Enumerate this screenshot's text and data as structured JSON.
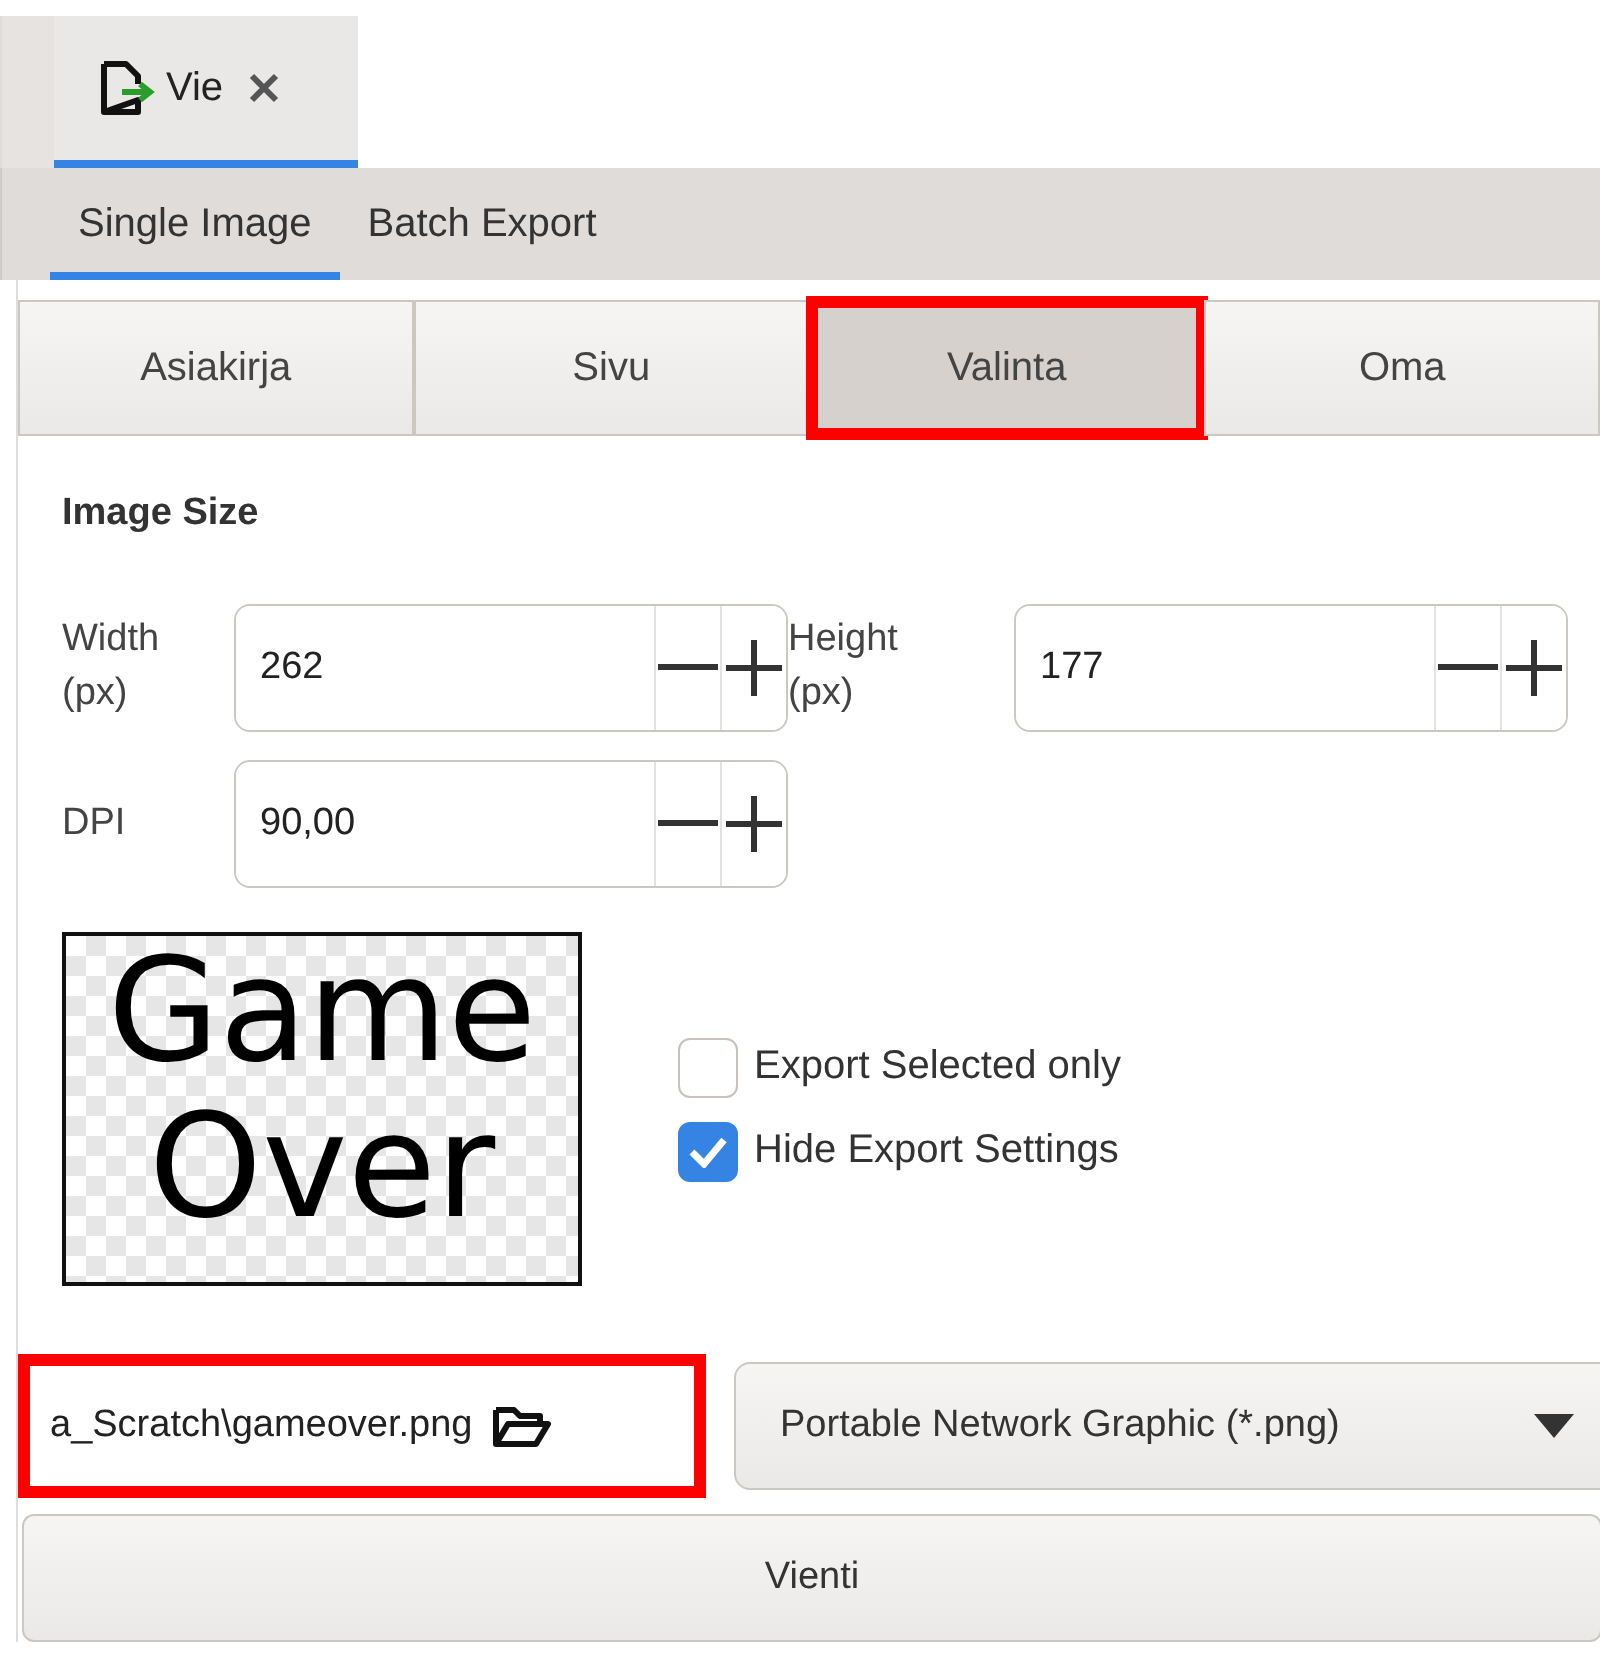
{
  "doc_tab": {
    "label": "Vie",
    "selected": true
  },
  "tabs": [
    {
      "label": "Single Image",
      "selected": true
    },
    {
      "label": "Batch Export",
      "selected": false
    }
  ],
  "scopes": [
    {
      "label": "Asiakirja",
      "selected": false,
      "highlighted": false
    },
    {
      "label": "Sivu",
      "selected": false,
      "highlighted": false
    },
    {
      "label": "Valinta",
      "selected": true,
      "highlighted": true
    },
    {
      "label": "Oma",
      "selected": false,
      "highlighted": false
    }
  ],
  "image_size": {
    "title": "Image Size",
    "fields": [
      {
        "label": "Width (px)",
        "value": "262"
      },
      {
        "label": "Height (px)",
        "value": "177"
      },
      {
        "label": "DPI",
        "value": "90,00"
      }
    ]
  },
  "preview": {
    "lines": [
      "Game",
      "Over"
    ]
  },
  "options": [
    {
      "label": "Export Selected only",
      "checked": false
    },
    {
      "label": "Hide Export Settings",
      "checked": true
    }
  ],
  "file": {
    "value": "a_Scratch\\gameover.png",
    "highlighted": true
  },
  "format": {
    "value": "Portable Network Graphic (*.png)"
  },
  "export_button": {
    "label": "Vienti"
  }
}
